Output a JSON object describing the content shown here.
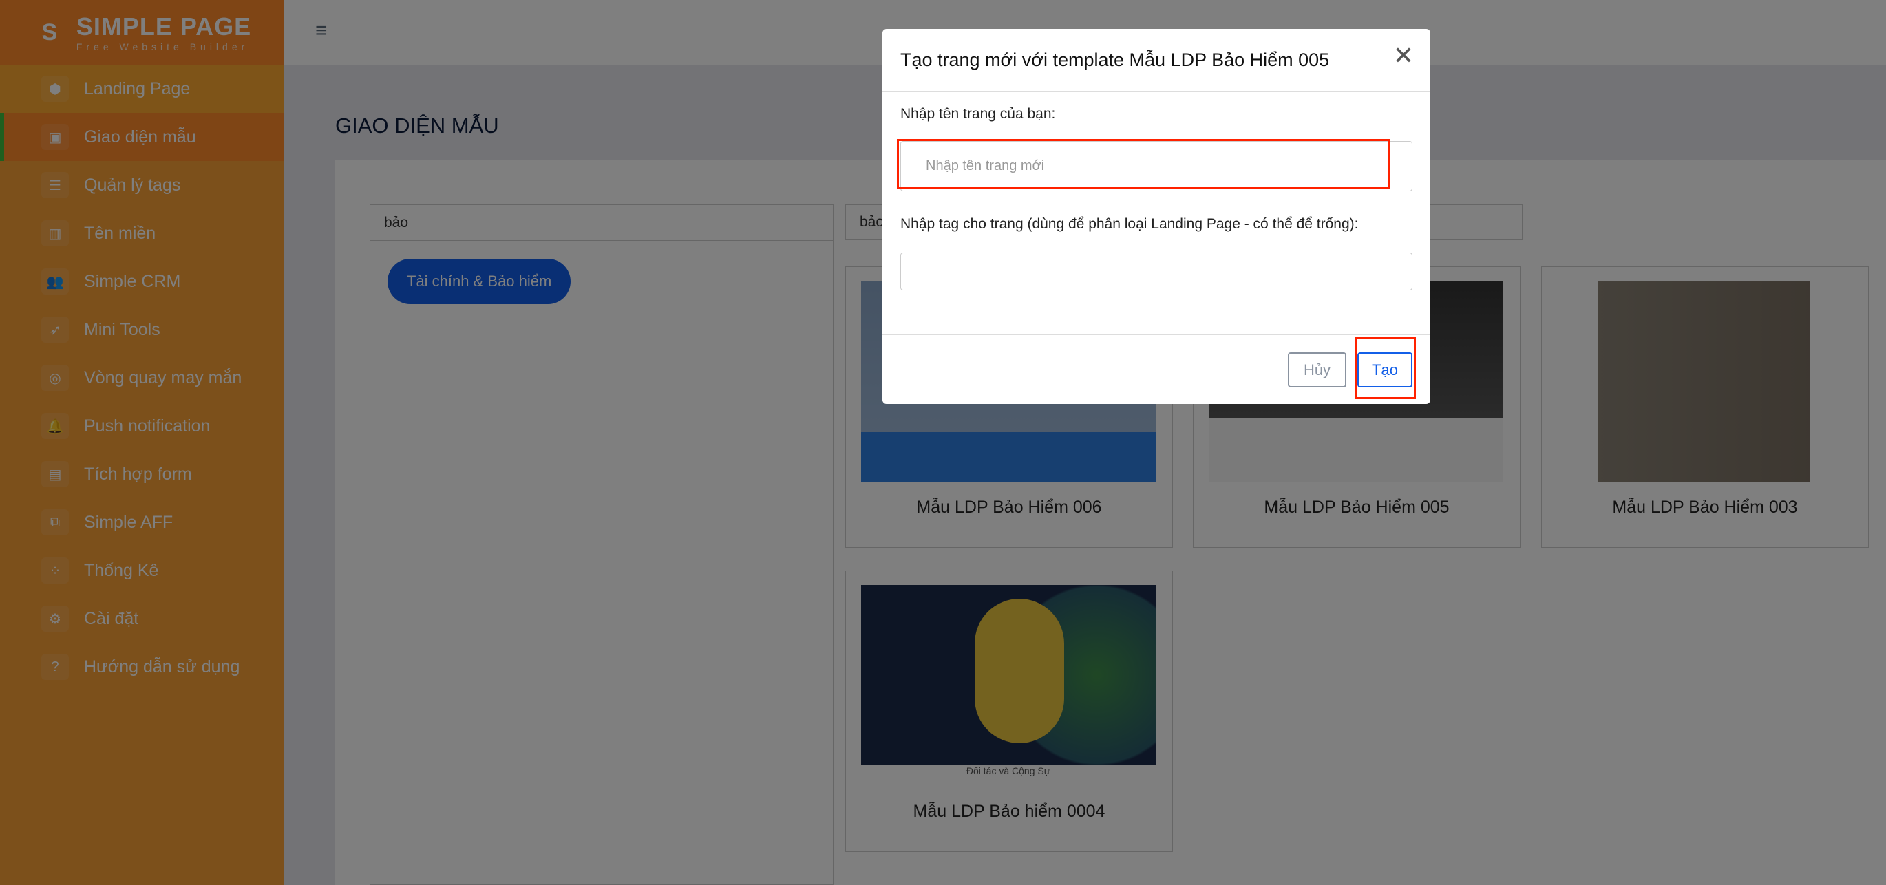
{
  "brand": {
    "name": "SIMPLE PAGE",
    "tagline": "Free Website Builder"
  },
  "sidebar": {
    "items": [
      {
        "label": "Landing Page",
        "icon": "cube-icon"
      },
      {
        "label": "Giao diện mẫu",
        "icon": "template-icon",
        "active": true
      },
      {
        "label": "Quản lý tags",
        "icon": "list-icon"
      },
      {
        "label": "Tên miền",
        "icon": "bar-chart-icon"
      },
      {
        "label": "Simple CRM",
        "icon": "users-icon"
      },
      {
        "label": "Mini Tools",
        "icon": "rocket-icon"
      },
      {
        "label": "Vòng quay may mắn",
        "icon": "target-icon"
      },
      {
        "label": "Push notification",
        "icon": "bell-icon"
      },
      {
        "label": "Tích hợp form",
        "icon": "form-icon"
      },
      {
        "label": "Simple AFF",
        "icon": "copy-icon"
      },
      {
        "label": "Thống Kê",
        "icon": "stats-icon"
      },
      {
        "label": "Cài đặt",
        "icon": "gear-icon"
      },
      {
        "label": "Hướng dẫn sử dụng",
        "icon": "help-icon"
      }
    ]
  },
  "page": {
    "title": "GIAO DIỆN MẪU"
  },
  "filters": {
    "tag_search": "bảo",
    "tags": [
      "Tài chính & Bảo hiểm"
    ],
    "template_search": "bảo"
  },
  "templates": [
    {
      "name": "Mẫu LDP Bảo Hiểm 006"
    },
    {
      "name": "Mẫu LDP Bảo Hiểm 005"
    },
    {
      "name": "Mẫu LDP Bảo Hiểm 003"
    },
    {
      "name": "Mẫu LDP Bảo hiểm 0004",
      "thumb_caption": "Đối tác và Cộng Sự"
    }
  ],
  "modal": {
    "title": "Tạo trang mới với template Mẫu LDP Bảo Hiểm 005",
    "name_label": "Nhập tên trang của bạn:",
    "name_placeholder": "Nhập tên trang mới",
    "name_value": "",
    "tag_label": "Nhập tag cho trang (dùng để phân loại Landing Page - có thể để trống):",
    "tag_value": "",
    "cancel": "Hủy",
    "create": "Tạo"
  },
  "colors": {
    "sidebar": "#f9a036",
    "accent": "#135fe8",
    "highlight": "#ff2200"
  }
}
